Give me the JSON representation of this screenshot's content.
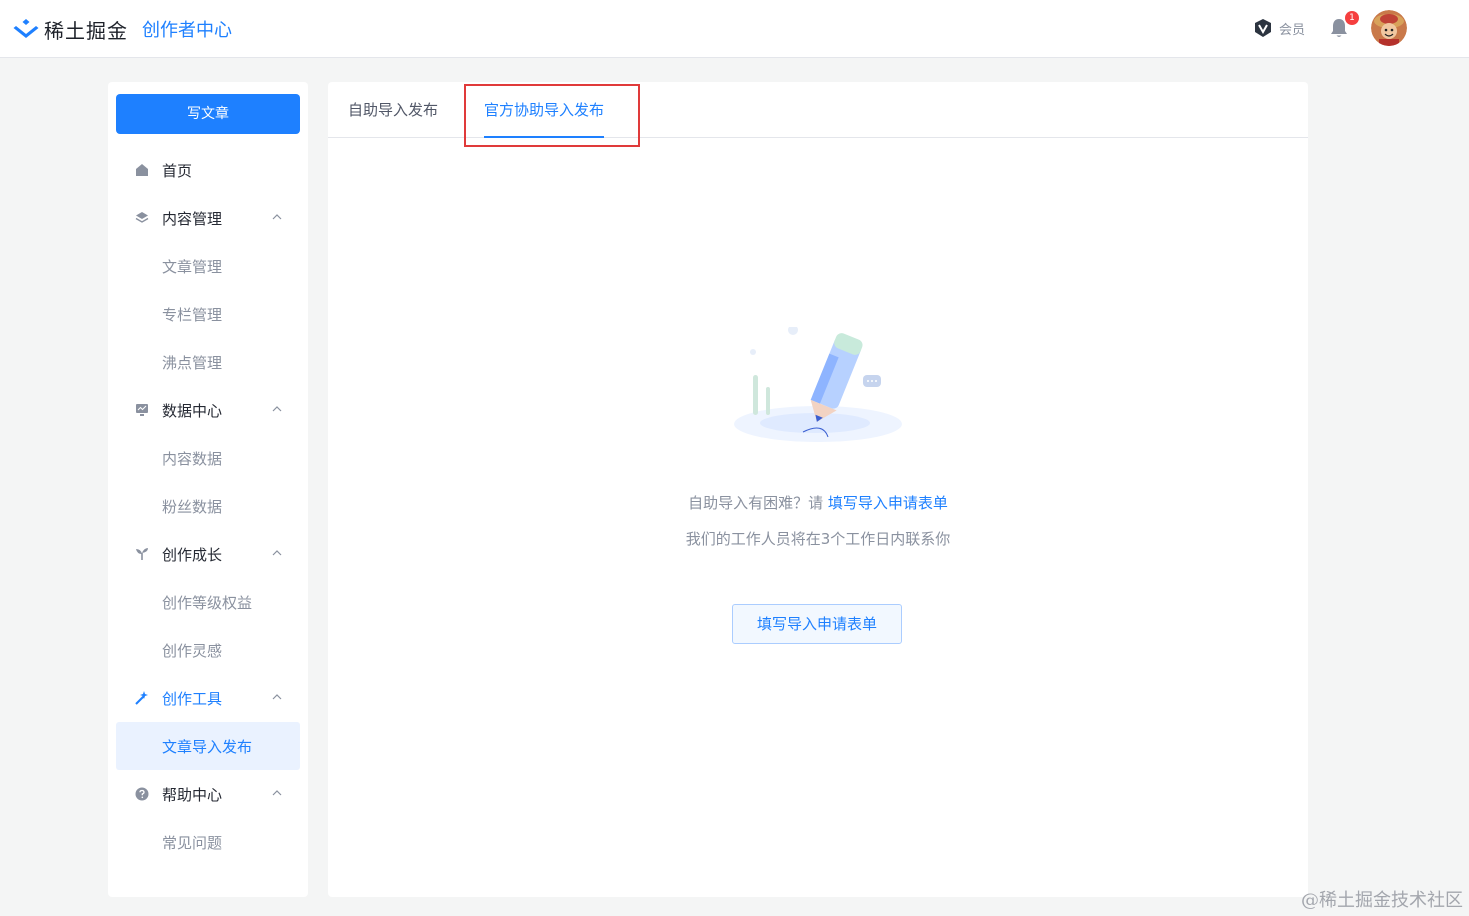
{
  "header": {
    "logo_text": "稀土掘金",
    "logo_sub": "创作者中心",
    "vip_label": "会员",
    "bell_badge": "1"
  },
  "sidebar": {
    "write_button": "写文章",
    "items": {
      "home": "首页",
      "content": "内容管理",
      "content_articles": "文章管理",
      "content_columns": "专栏管理",
      "content_pins": "沸点管理",
      "data": "数据中心",
      "data_content": "内容数据",
      "data_fans": "粉丝数据",
      "growth": "创作成长",
      "growth_level": "创作等级权益",
      "growth_inspire": "创作灵感",
      "tools": "创作工具",
      "tools_import": "文章导入发布",
      "help": "帮助中心",
      "help_faq": "常见问题"
    }
  },
  "main": {
    "tabs": [
      {
        "label": "自助导入发布"
      },
      {
        "label": "官方协助导入发布"
      }
    ],
    "hint_prefix": "自助导入有困难？请 ",
    "hint_link": "填写导入申请表单",
    "hint_line2": "我们的工作人员将在3个工作日内联系你",
    "form_button": "填写导入申请表单"
  },
  "watermark": "@稀土掘金技术社区",
  "colors": {
    "accent": "#1e80ff",
    "highlight_border": "#e03a3a",
    "selected_bg": "#eaf2ff"
  }
}
